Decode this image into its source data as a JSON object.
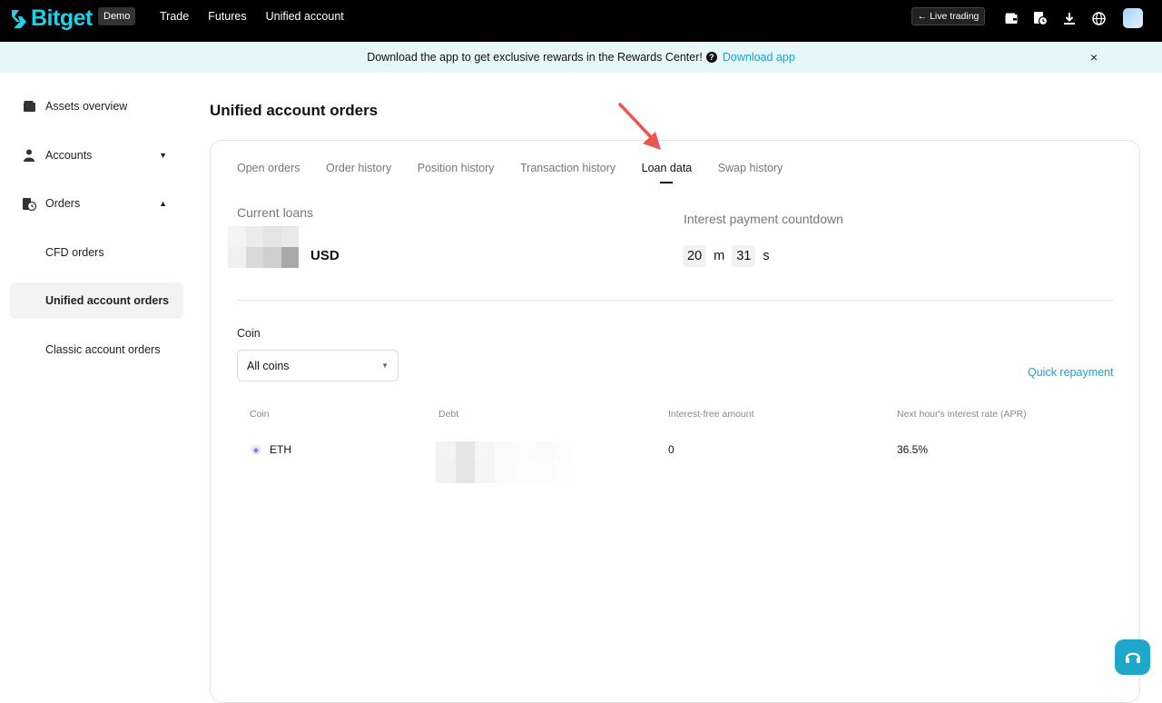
{
  "header": {
    "brand": "Bitget",
    "demo_badge": "Demo",
    "nav": [
      "Trade",
      "Futures",
      "Unified account"
    ],
    "live_trading": "Live trading",
    "icons": [
      "wallet-icon",
      "orders-clock-icon",
      "download-icon",
      "globe-icon",
      "avatar"
    ]
  },
  "banner": {
    "text": "Download the app to get exclusive rewards in the Rewards Center!",
    "link": "Download app",
    "close": "×"
  },
  "sidebar": {
    "items": [
      {
        "label": "Assets overview",
        "icon": "wallet-icon"
      },
      {
        "label": "Accounts",
        "icon": "user-icon",
        "caret": "▼"
      },
      {
        "label": "Orders",
        "icon": "orders-icon",
        "caret": "▲"
      },
      {
        "label": "CFD orders"
      },
      {
        "label": "Unified account orders"
      },
      {
        "label": "Classic account orders"
      }
    ]
  },
  "main": {
    "title": "Unified account orders",
    "tabs": [
      "Open orders",
      "Order history",
      "Position history",
      "Transaction history",
      "Loan data",
      "Swap history"
    ],
    "active_tab": "Loan data",
    "current_loans_label": "Current loans",
    "currency": "USD",
    "countdown_label": "Interest payment countdown",
    "countdown": {
      "minutes": "20",
      "m_unit": "m",
      "seconds": "31",
      "s_unit": "s"
    },
    "coin_label": "Coin",
    "coin_select": "All coins",
    "quick_repayment": "Quick repayment",
    "table": {
      "headers": [
        "Coin",
        "Debt",
        "Interest-free amount",
        "Next hour's interest rate (APR)"
      ],
      "rows": [
        {
          "coin": "ETH",
          "debt": "",
          "interest_free": "0",
          "rate": "36.5%"
        }
      ]
    }
  },
  "colors": {
    "accent": "#1aa3cc",
    "brand": "#1fd0e6",
    "arrow": "#f0544f"
  }
}
